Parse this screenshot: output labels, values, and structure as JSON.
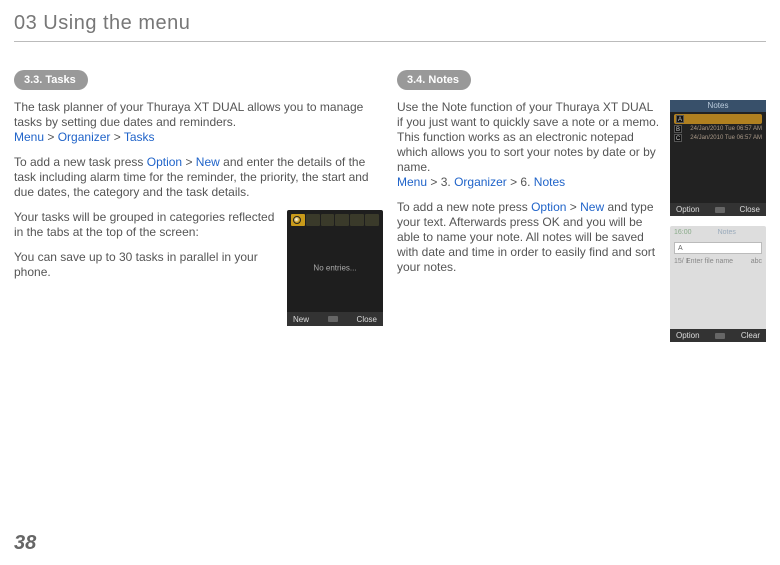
{
  "chapter": {
    "title": "03 Using the menu"
  },
  "page_number": "38",
  "left": {
    "section_label": "3.3. Tasks",
    "intro": "The task planner of your Thuraya XT DUAL allows you to manage tasks by setting due dates and reminders.",
    "crumbs": {
      "a": "Menu",
      "b": "Organizer",
      "c": "Tasks",
      "gt": " > "
    },
    "para2_pre": "To add a new task press ",
    "para2_opt": "Option",
    "para2_gt": " > ",
    "para2_new": "New",
    "para2_post": " and enter the details of the task including alarm time for the reminder, the priority, the start and due dates, the category and the task details.",
    "para3": "Your tasks will be grouped in categories reflected in the tabs at the top of the screen:",
    "para4": "You can save up to 30 tasks in parallel in your phone.",
    "phone": {
      "center": "No entries...",
      "soft_left": "New",
      "soft_right": "Close"
    }
  },
  "right": {
    "section_label": "3.4. Notes",
    "intro": "Use the Note function of your Thuraya XT DUAL if you just want to quickly save a note or a memo. This function works as an electronic notepad which allows you to sort your notes by date or by name.",
    "crumbs": {
      "a": "Menu",
      "b": "Organizer",
      "c": "Notes",
      "gt": " > 3. ",
      "gt2": " > 6. "
    },
    "para2_pre": "To add a new note press ",
    "para2_opt": "Option",
    "para2_gt": " > ",
    "para2_new": "New",
    "para2_post": " and type your text. Afterwards press OK and you will be able to name your note. All notes will be saved with date and time in order to easily find and sort your notes.",
    "notes_screen": {
      "title": "Notes",
      "rows": [
        {
          "label": "A",
          "right": ""
        },
        {
          "label": "B",
          "right": "24/Jan/2010 Tue 06:57 AM"
        },
        {
          "label": "C",
          "right": "24/Jan/2010 Tue 06:57 AM"
        }
      ],
      "soft_left": "Option",
      "soft_right": "Close"
    },
    "edit_screen": {
      "time": "16:00",
      "title": "Notes",
      "field_value": "A",
      "counter": "15/\n1",
      "prompt": "Enter file name",
      "mode": "abc",
      "soft_left": "Option",
      "soft_right": "Clear"
    }
  }
}
